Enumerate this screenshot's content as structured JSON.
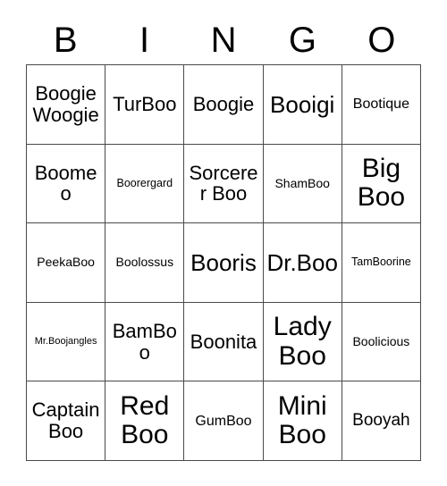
{
  "title": "BINGO Card",
  "header": {
    "letters": [
      "B",
      "I",
      "N",
      "G",
      "O"
    ]
  },
  "grid": {
    "rows": 5,
    "columns": 5,
    "border_color": "#4a4a4a",
    "background_color": "#ffffff",
    "text_color": "#000000",
    "cells": [
      {
        "text": "Boogie Woogie",
        "size": "xl"
      },
      {
        "text": "TurBoo",
        "size": "xl"
      },
      {
        "text": "Boogie",
        "size": "xl"
      },
      {
        "text": "Booigi",
        "size": "xxl"
      },
      {
        "text": "Bootique",
        "size": "m"
      },
      {
        "text": "Boomeo",
        "size": "xl"
      },
      {
        "text": "Boorergard",
        "size": "xs"
      },
      {
        "text": "Sorcerer Boo",
        "size": "xl"
      },
      {
        "text": "ShamBoo",
        "size": "s"
      },
      {
        "text": "Big Boo",
        "size": "h1"
      },
      {
        "text": "PeekaBoo",
        "size": "s"
      },
      {
        "text": "Boolossus",
        "size": "s"
      },
      {
        "text": "Booris",
        "size": "xxl"
      },
      {
        "text": "Dr.Boo",
        "size": "xxl"
      },
      {
        "text": "TamBoorine",
        "size": "xs"
      },
      {
        "text": "Mr.Boojangles",
        "size": "xxs"
      },
      {
        "text": "BamBoo",
        "size": "xl"
      },
      {
        "text": "Boonita",
        "size": "xl"
      },
      {
        "text": "Lady Boo",
        "size": "h1"
      },
      {
        "text": "Boolicious",
        "size": "s"
      },
      {
        "text": "Captain Boo",
        "size": "xl"
      },
      {
        "text": "Red Boo",
        "size": "h1"
      },
      {
        "text": "GumBoo",
        "size": "m"
      },
      {
        "text": "Mini Boo",
        "size": "h1"
      },
      {
        "text": "Booyah",
        "size": "l"
      }
    ]
  }
}
